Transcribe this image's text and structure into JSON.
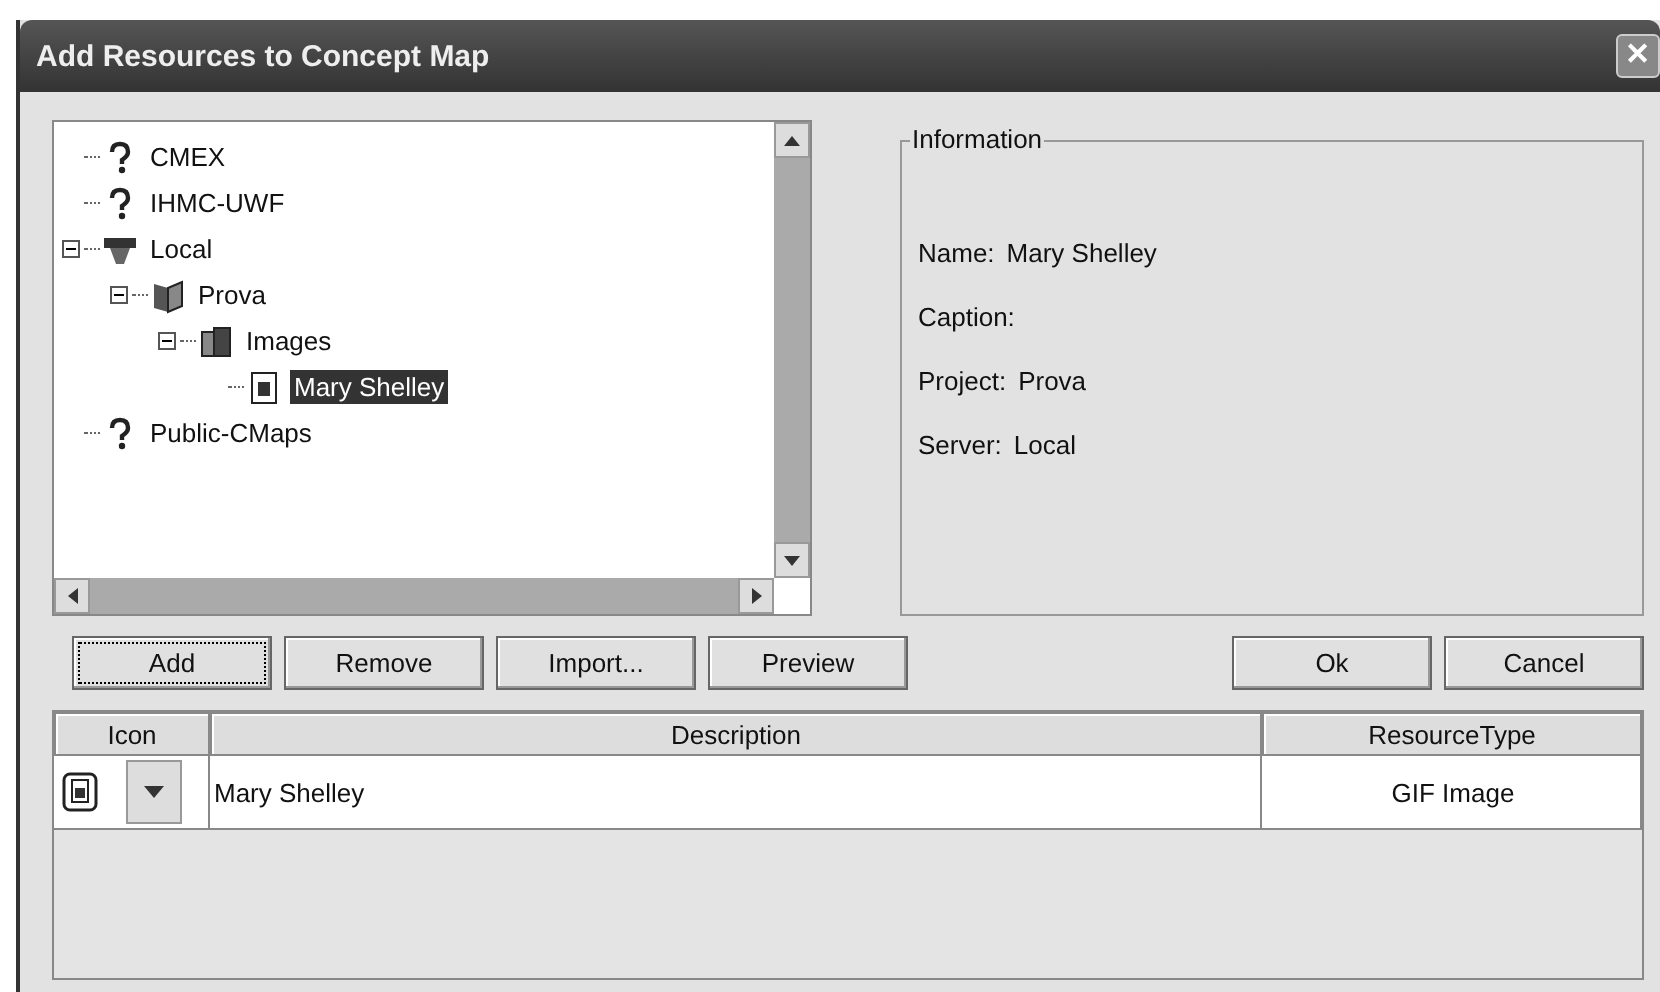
{
  "window": {
    "title": "Add Resources to Concept Map",
    "close": "✕"
  },
  "tree": [
    {
      "label": "CMEX",
      "kind": "question",
      "selected": false
    },
    {
      "label": "IHMC-UWF",
      "kind": "question",
      "selected": false
    },
    {
      "label": "Local",
      "kind": "server",
      "selected": false,
      "expanded": true,
      "children": [
        {
          "label": "Prova",
          "kind": "folder",
          "selected": false,
          "expanded": true,
          "children": [
            {
              "label": "Images",
              "kind": "images",
              "selected": false,
              "expanded": true,
              "children": [
                {
                  "label": "Mary Shelley",
                  "kind": "file",
                  "selected": true
                }
              ]
            }
          ]
        }
      ]
    },
    {
      "label": "Public-CMaps",
      "kind": "question",
      "selected": false
    }
  ],
  "information": {
    "title": "Information",
    "fields": [
      {
        "label": "Name:",
        "value": "Mary Shelley"
      },
      {
        "label": "Caption:"
      },
      {
        "label": "Project:",
        "value": "Prova"
      },
      {
        "label": "Server:",
        "value": "Local"
      }
    ]
  },
  "buttons_left": [
    {
      "label": "Add",
      "focused": true
    },
    {
      "label": "Remove",
      "focused": false
    },
    {
      "label": "Import...",
      "focused": false
    },
    {
      "label": "Preview",
      "focused": false
    }
  ],
  "buttons_right": [
    {
      "label": "Ok",
      "focused": false
    },
    {
      "label": "Cancel",
      "focused": false
    }
  ],
  "table": {
    "columns": [
      "Icon",
      "Description",
      "ResourceType"
    ],
    "rows": [
      {
        "description": "Mary Shelley",
        "type": "GIF Image"
      }
    ]
  }
}
